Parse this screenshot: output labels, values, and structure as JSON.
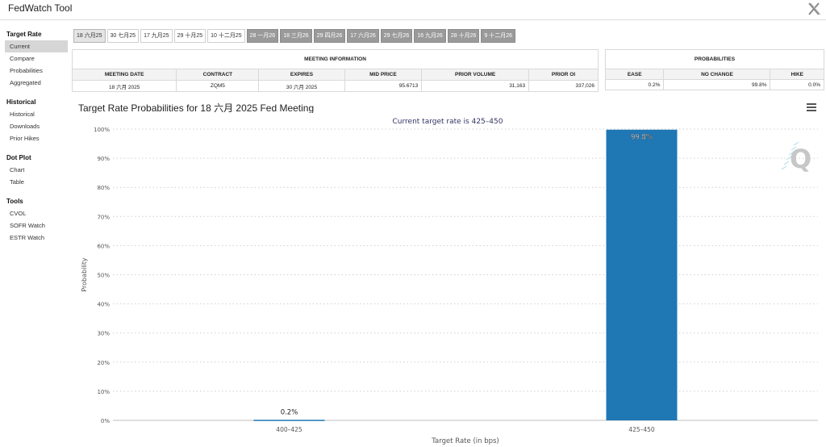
{
  "app": {
    "title": "FedWatch Tool"
  },
  "sidebar": {
    "sections": [
      {
        "heading": "Target Rate",
        "items": [
          "Current",
          "Compare",
          "Probabilities",
          "Aggregated"
        ],
        "active": 0
      },
      {
        "heading": "Historical",
        "items": [
          "Historical",
          "Downloads",
          "Prior Hikes"
        ],
        "active": -1
      },
      {
        "heading": "Dot Plot",
        "items": [
          "Chart",
          "Table"
        ],
        "active": -1
      },
      {
        "heading": "Tools",
        "items": [
          "CVOL",
          "SOFR Watch",
          "ESTR Watch"
        ],
        "active": -1
      }
    ]
  },
  "tabs": {
    "items": [
      "18 六月25",
      "30 七月25",
      "17 九月25",
      "29 十月25",
      "10 十二月25",
      "28 一月26",
      "18 三月26",
      "29 四月26",
      "17 六月26",
      "29 七月26",
      "16 九月26",
      "28 十月26",
      "9 十二月26"
    ],
    "selected": 0,
    "dark_from": 5
  },
  "meeting_info": {
    "group_header": "MEETING INFORMATION",
    "headers": [
      "MEETING DATE",
      "CONTRACT",
      "EXPIRES",
      "MID PRICE",
      "PRIOR VOLUME",
      "PRIOR OI"
    ],
    "row": [
      "18 六月 2025",
      "ZQM5",
      "30 六月 2025",
      "95.6713",
      "31,163",
      "337,026"
    ]
  },
  "probabilities": {
    "group_header": "PROBABILITIES",
    "headers": [
      "EASE",
      "NO CHANGE",
      "HIKE"
    ],
    "row": [
      "0.2%",
      "99.8%",
      "0.0%"
    ]
  },
  "chart": {
    "title": "Target Rate Probabilities for 18 六月 2025 Fed Meeting",
    "subtitle": "Current target rate is 425–450",
    "menu_icon": "hamburger-menu-icon",
    "watermark_icon": "q-logo-icon"
  },
  "chart_data": {
    "type": "bar",
    "title": "Target Rate Probabilities for 18 六月 2025 Fed Meeting",
    "subtitle": "Current target rate is 425–450",
    "categories": [
      "400–425",
      "425–450"
    ],
    "values": [
      0.2,
      99.8
    ],
    "data_labels": [
      "0.2%",
      "99.8%"
    ],
    "xlabel": "Target Rate (in bps)",
    "ylabel": "Probability",
    "ylim": [
      0,
      100
    ],
    "yticks": [
      "0%",
      "10%",
      "20%",
      "30%",
      "40%",
      "50%",
      "60%",
      "70%",
      "80%",
      "90%",
      "100%"
    ],
    "bar_color": "#1f77b4",
    "grid": true
  }
}
